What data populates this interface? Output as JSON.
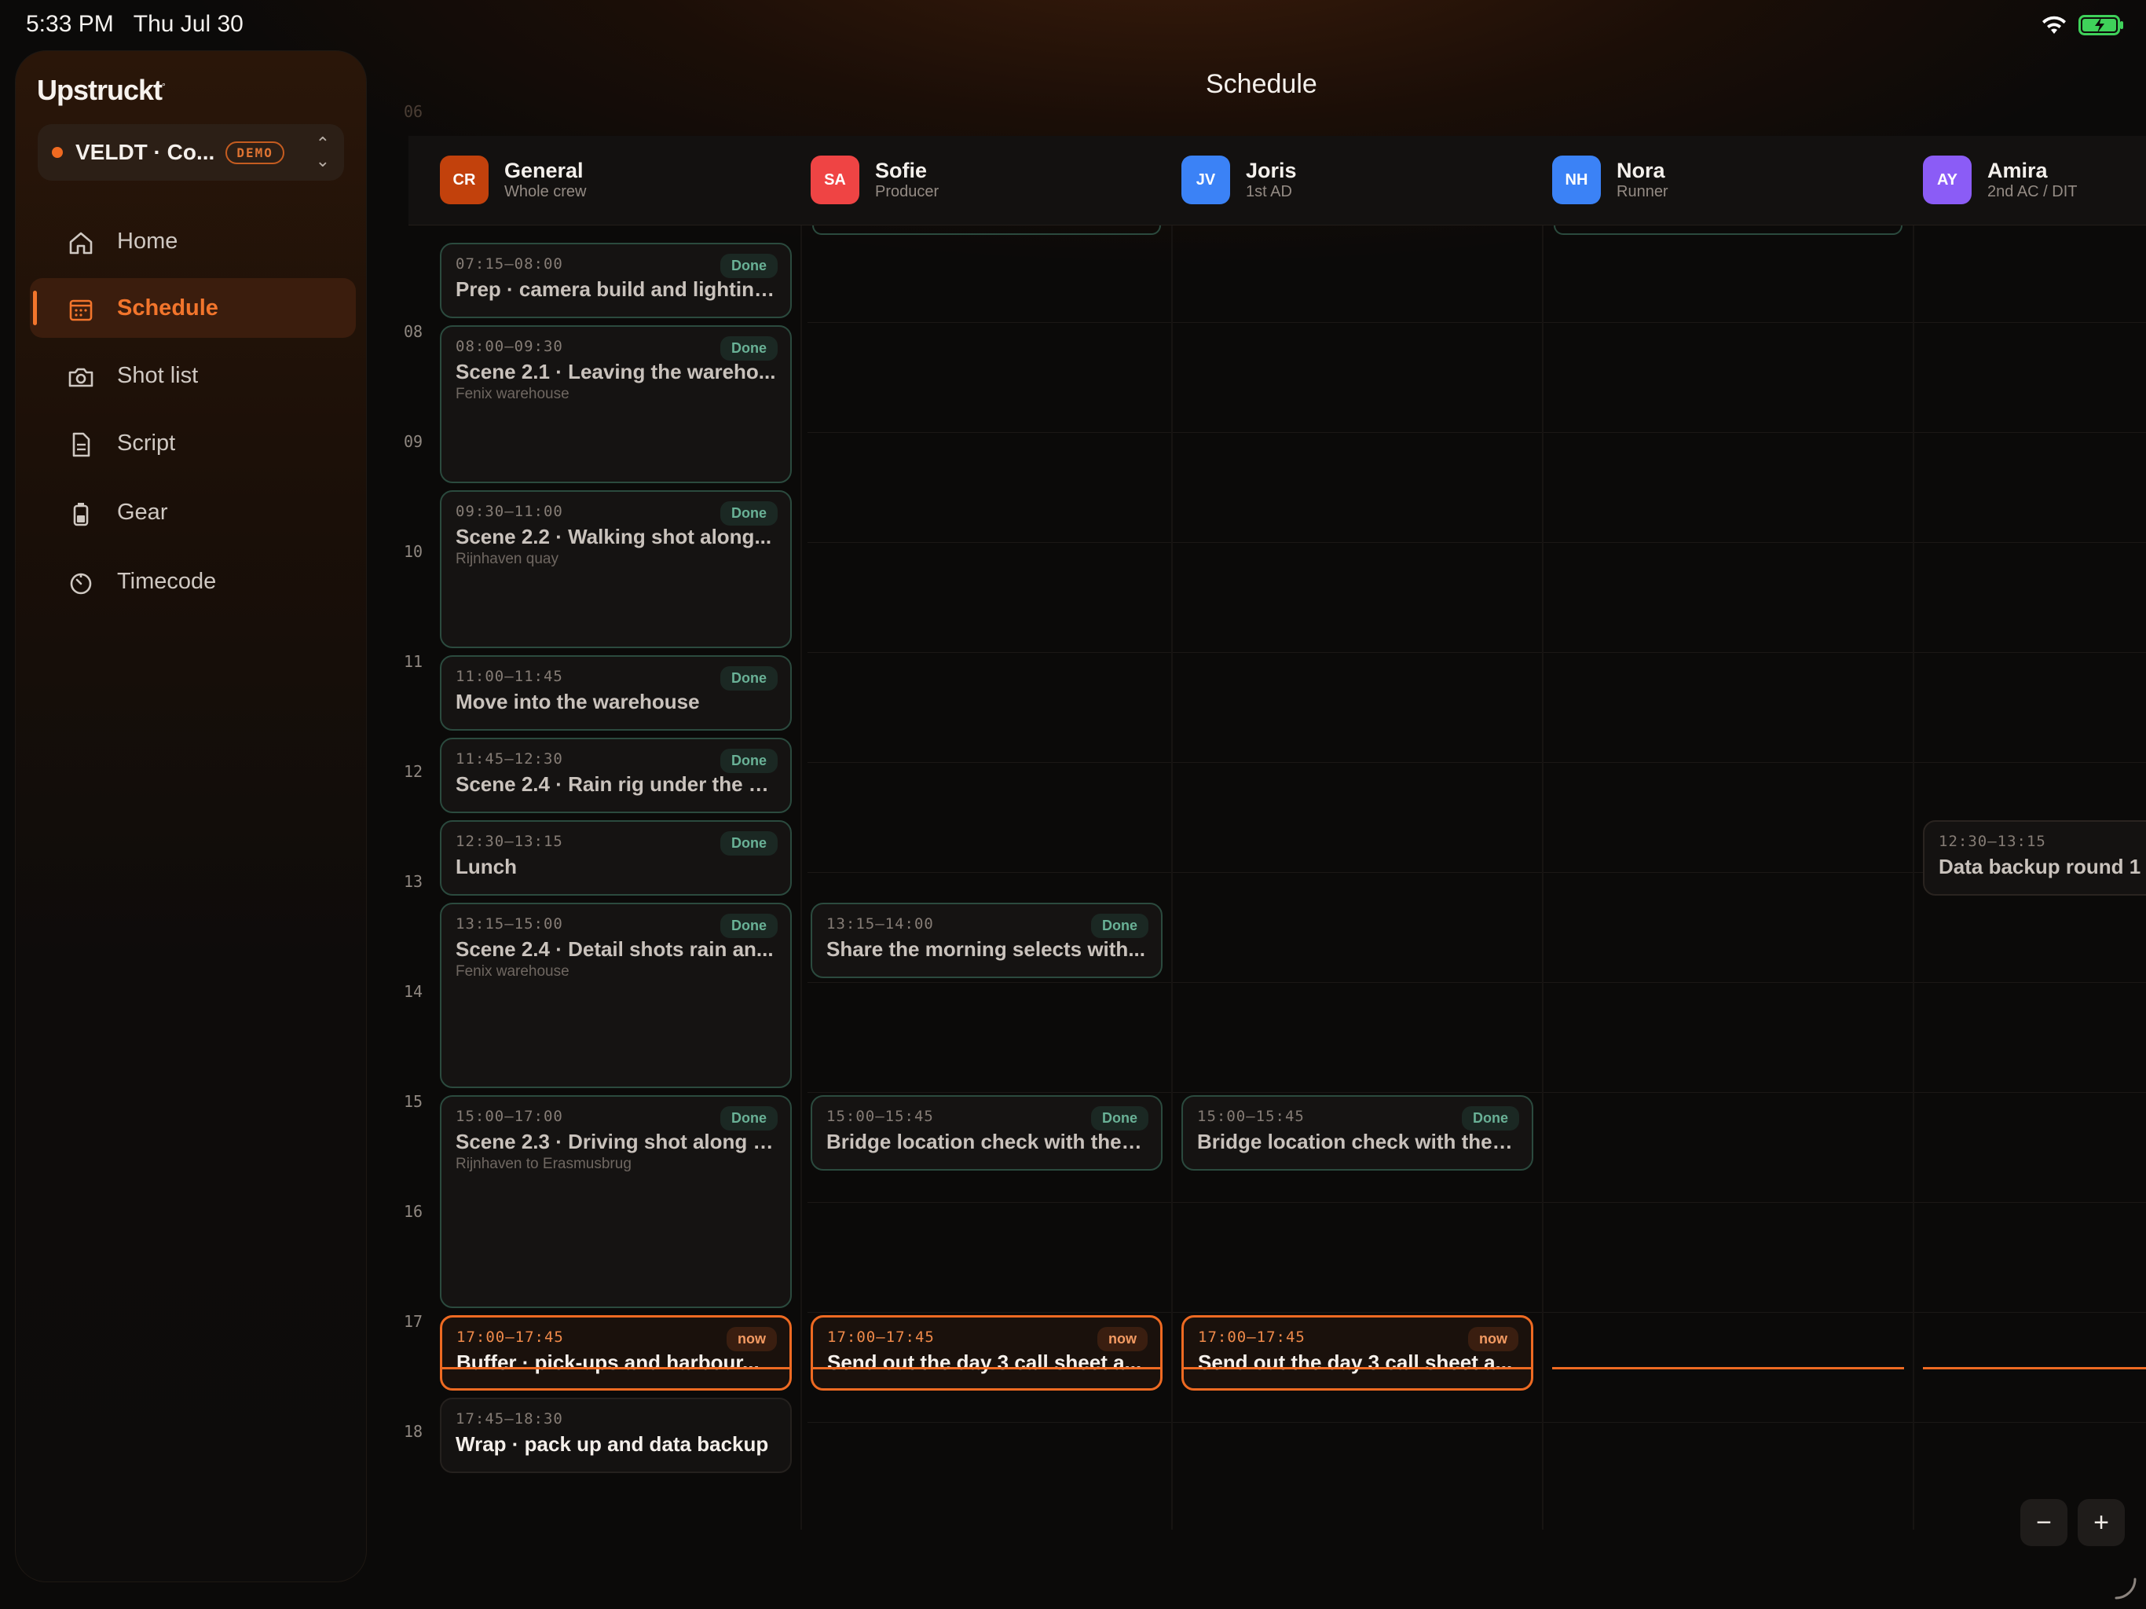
{
  "status_bar": {
    "time": "5:33 PM",
    "date": "Thu Jul 30"
  },
  "app": {
    "brand": "Upstruckt",
    "page_title": "Schedule"
  },
  "project": {
    "name": "VELDT · Co...",
    "badge": "DEMO"
  },
  "nav": [
    {
      "label": "Home",
      "icon": "home-icon"
    },
    {
      "label": "Schedule",
      "icon": "calendar-icon",
      "active": true
    },
    {
      "label": "Shot list",
      "icon": "camera-icon"
    },
    {
      "label": "Script",
      "icon": "document-icon"
    },
    {
      "label": "Gear",
      "icon": "battery-icon"
    },
    {
      "label": "Timecode",
      "icon": "timer-icon"
    }
  ],
  "people": [
    {
      "initials": "CR",
      "name": "General",
      "role": "Whole crew",
      "color": "#c2410c"
    },
    {
      "initials": "SA",
      "name": "Sofie",
      "role": "Producer",
      "color": "#ef4444"
    },
    {
      "initials": "JV",
      "name": "Joris",
      "role": "1st AD",
      "color": "#3b82f6"
    },
    {
      "initials": "NH",
      "name": "Nora",
      "role": "Runner",
      "color": "#3b82f6"
    },
    {
      "initials": "AY",
      "name": "Amira",
      "role": "2nd AC / DIT",
      "color": "#8b5cf6"
    }
  ],
  "hours": [
    "06",
    "08",
    "09",
    "10",
    "11",
    "12",
    "13",
    "14",
    "15",
    "16",
    "17",
    "18"
  ],
  "events": {
    "general": [
      {
        "time": "07:15–08:00",
        "title": "Prep · camera build and lighting...",
        "location": "",
        "status": "Done"
      },
      {
        "time": "08:00–09:30",
        "title": "Scene 2.1 · Leaving the wareho...",
        "location": "Fenix warehouse",
        "status": "Done"
      },
      {
        "time": "09:30–11:00",
        "title": "Scene 2.2 · Walking shot along...",
        "location": "Rijnhaven quay",
        "status": "Done"
      },
      {
        "time": "11:00–11:45",
        "title": "Move into the warehouse",
        "location": "",
        "status": "Done"
      },
      {
        "time": "11:45–12:30",
        "title": "Scene 2.4 · Rain rig under the w...",
        "location": "",
        "status": "Done"
      },
      {
        "time": "12:30–13:15",
        "title": "Lunch",
        "location": "",
        "status": "Done"
      },
      {
        "time": "13:15–15:00",
        "title": "Scene 2.4 · Detail shots rain an...",
        "location": "Fenix warehouse",
        "status": "Done"
      },
      {
        "time": "15:00–17:00",
        "title": "Scene 2.3 · Driving shot along t...",
        "location": "Rijnhaven to Erasmusbrug",
        "status": "Done"
      },
      {
        "time": "17:00–17:45",
        "title": "Buffer · pick-ups and harbour...",
        "location": "",
        "status": "now"
      },
      {
        "time": "17:45–18:30",
        "title": "Wrap · pack up and data backup",
        "location": "",
        "status": ""
      }
    ],
    "sofie": [
      {
        "time": "13:15–14:00",
        "title": "Share the morning selects with...",
        "status": "Done"
      },
      {
        "time": "15:00–15:45",
        "title": "Bridge location check with the t...",
        "status": "Done"
      },
      {
        "time": "17:00–17:45",
        "title": "Send out the day 3 call sheet a...",
        "status": "now"
      }
    ],
    "joris": [
      {
        "time": "15:00–15:45",
        "title": "Bridge location check with the t...",
        "status": "Done"
      },
      {
        "time": "17:00–17:45",
        "title": "Send out the day 3 call sheet a...",
        "status": "now"
      }
    ],
    "amira": [
      {
        "time": "12:30–13:15",
        "title": "Data backup round 1",
        "status": ""
      }
    ]
  },
  "zoom": {
    "out": "−",
    "in": "+"
  },
  "colors": {
    "accent": "#ee6a22",
    "done": "#69b196",
    "background": "#0b0a09"
  }
}
